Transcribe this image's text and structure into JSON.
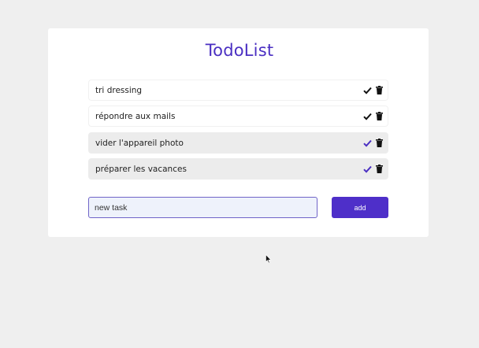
{
  "app": {
    "title": "TodoList"
  },
  "tasks": [
    {
      "label": "tri dressing",
      "done": false,
      "check_color": "#111111",
      "check_icon": "check-icon",
      "delete_icon": "trash-icon"
    },
    {
      "label": "répondre aux mails",
      "done": false,
      "check_color": "#111111",
      "check_icon": "check-icon",
      "delete_icon": "trash-icon"
    },
    {
      "label": "vider l'appareil photo",
      "done": true,
      "check_color": "#4a2fc2",
      "check_icon": "check-icon",
      "delete_icon": "trash-icon"
    },
    {
      "label": "préparer les vacances",
      "done": true,
      "check_color": "#4a2fc2",
      "check_icon": "check-icon",
      "delete_icon": "trash-icon"
    }
  ],
  "form": {
    "input_value": "new task",
    "add_label": "add"
  },
  "colors": {
    "accent": "#4e2fc9",
    "title": "#4a2fc2",
    "background": "#efefef",
    "done_row": "#ececec"
  }
}
